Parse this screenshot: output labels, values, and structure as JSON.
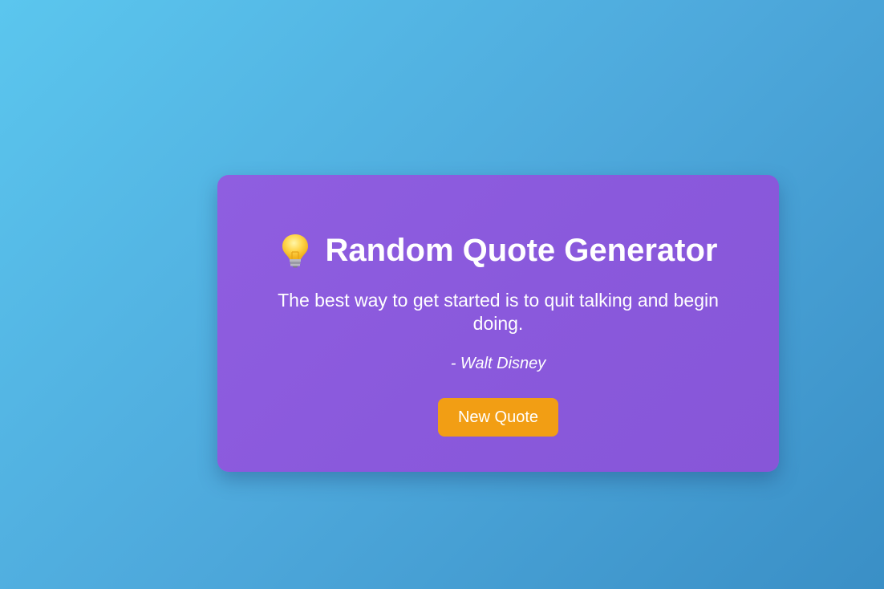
{
  "app": {
    "title": "Random Quote Generator",
    "title_icon": "lightbulb-icon"
  },
  "quote": {
    "text": "The best way to get started is to quit talking and begin doing.",
    "author": "- Walt Disney"
  },
  "actions": {
    "new_quote_label": "New Quote"
  },
  "colors": {
    "background_start": "#5bc6ee",
    "background_end": "#3a8fc6",
    "card": "#8a59dc",
    "button": "#f29e14",
    "text": "#ffffff"
  }
}
